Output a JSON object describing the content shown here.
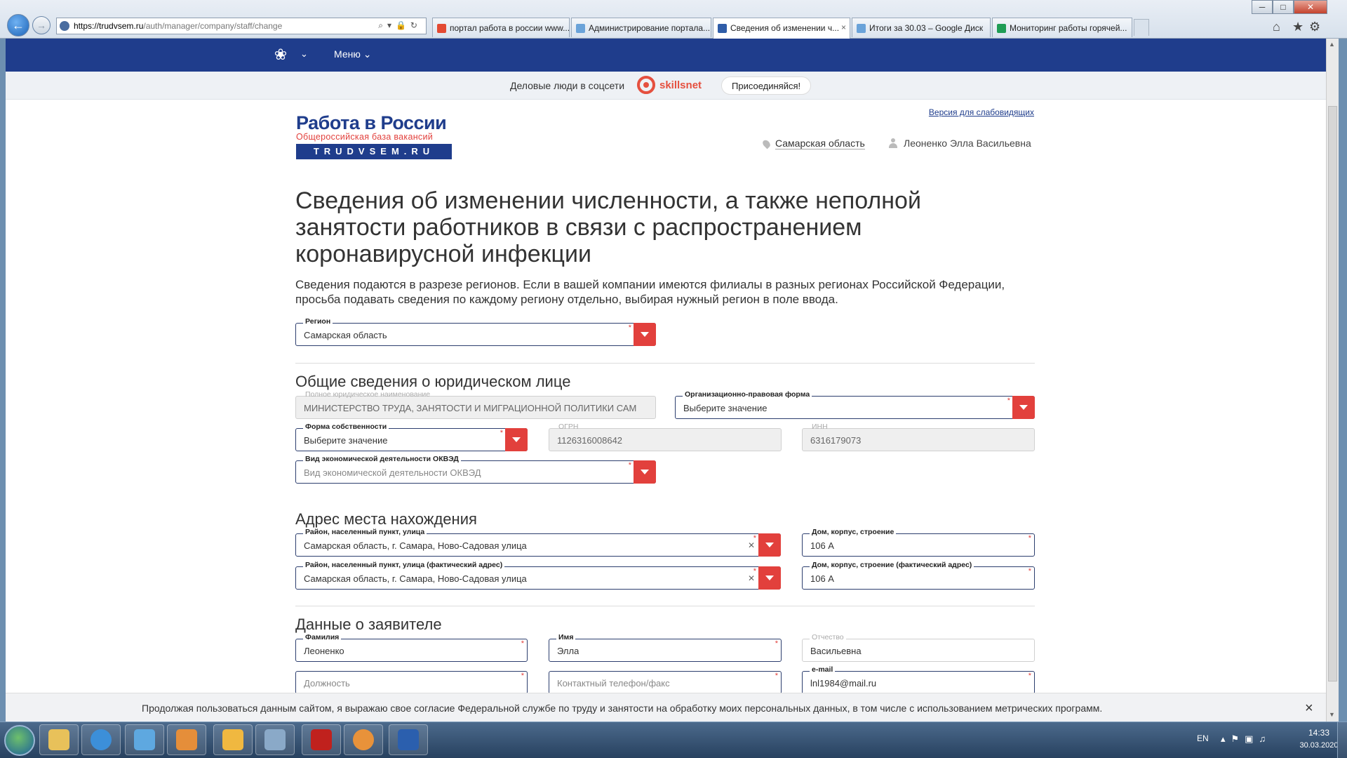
{
  "browser": {
    "url_host": "https://trudvsem.ru",
    "url_path": "/auth/manager/company/staff/change",
    "tabs": [
      {
        "label": "портал работа в россии www....",
        "fav": "#e34a33"
      },
      {
        "label": "Администрирование портала...",
        "fav": "#6aa3d9"
      },
      {
        "label": "Сведения об изменении ч...",
        "fav": "#2f5da8"
      },
      {
        "label": "Итоги за 30.03 – Google Диск",
        "fav": "#6aa3d9"
      },
      {
        "label": "Мониторинг работы горячей...",
        "fav": "#1f9d55"
      }
    ],
    "tab_close": "×"
  },
  "nav": {
    "menu_label": "Меню"
  },
  "promo": {
    "text": "Деловые люди в соцсети",
    "brand": "skillsnet",
    "join_label": "Присоединяйся!"
  },
  "header": {
    "logo_title": "Работа в России",
    "logo_subtitle": "Общероссийская база вакансий",
    "logo_url": "TRUDVSEM.RU",
    "accessible_version": "Версия для слабовидящих",
    "region": "Самарская область",
    "user": "Леоненко Элла Васильевна"
  },
  "main": {
    "title": "Сведения об изменении численности, а также неполной занятости работников в связи с распространением коронавирусной инфекции",
    "intro": "Сведения подаются в разрезе регионов. Если в вашей компании имеются филиалы в разных регионах Российской Федерации, просьба подавать сведения по каждому региону отдельно, выбирая нужный регион в поле ввода.",
    "region_field": {
      "label": "Регион",
      "value": "Самарская область"
    },
    "legal": {
      "title": "Общие сведения о юридическом лице",
      "full_name": {
        "label": "Полное юридическое наименование",
        "value": "МИНИСТЕРСТВО ТРУДА, ЗАНЯТОСТИ И МИГРАЦИОННОЙ ПОЛИТИКИ САМ"
      },
      "org_form": {
        "label": "Организационно-правовая форма",
        "value": "Выберите значение"
      },
      "ownership": {
        "label": "Форма собственности",
        "value": "Выберите значение"
      },
      "ogrn": {
        "label": "ОГРН",
        "value": "1126316008642"
      },
      "inn": {
        "label": "ИНН",
        "value": "6316179073"
      },
      "okved": {
        "label": "Вид экономической деятельности ОКВЭД",
        "placeholder": "Вид экономической деятельности ОКВЭД"
      }
    },
    "address": {
      "title": "Адрес места нахождения",
      "street": {
        "label": "Район, населенный пункт, улица",
        "value": "Самарская область, г. Самара, Ново-Садовая улица"
      },
      "house": {
        "label": "Дом, корпус, строение",
        "value": "106 А"
      },
      "street_actual": {
        "label": "Район, населенный пункт, улица (фактический адрес)",
        "value": "Самарская область, г. Самара, Ново-Садовая улица"
      },
      "house_actual": {
        "label": "Дом, корпус, строение (фактический адрес)",
        "value": "106 А"
      }
    },
    "applicant": {
      "title": "Данные о заявителе",
      "surname": {
        "label": "Фамилия",
        "value": "Леоненко"
      },
      "name": {
        "label": "Имя",
        "value": "Элла"
      },
      "patronymic": {
        "label": "Отчество",
        "value": "Васильевна"
      },
      "position": {
        "placeholder": "Должность"
      },
      "phone": {
        "placeholder": "Контактный телефон/факс"
      },
      "email": {
        "label": "e-mail",
        "value": "lnl1984@mail.ru"
      }
    }
  },
  "cookie": {
    "text": "Продолжая пользоваться данным сайтом, я выражаю свое согласие Федеральной службе по труду и занятости на обработку моих персональных данных, в том числе с использованием метрических программ.",
    "close": "×"
  },
  "tray": {
    "lang": "EN",
    "time": "14:33",
    "date": "30.03.2020"
  }
}
